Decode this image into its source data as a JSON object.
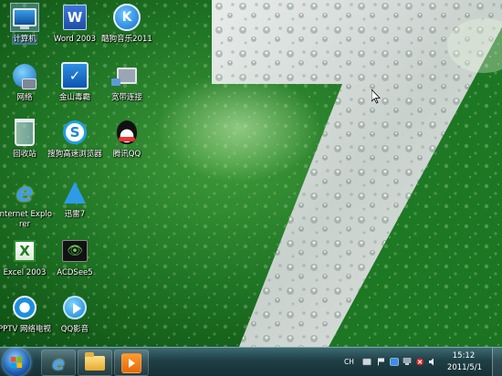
{
  "desktop": {
    "icons": [
      {
        "label": "计算机",
        "icon": "computer-icon"
      },
      {
        "label": "Word 2003",
        "icon": "word-icon"
      },
      {
        "label": "酷狗音乐2011",
        "icon": "kugou-icon"
      },
      {
        "label": "网络",
        "icon": "network-icon"
      },
      {
        "label": "金山毒霸",
        "icon": "jinshan-antivirus-icon"
      },
      {
        "label": "宽带连接",
        "icon": "broadband-connection-icon"
      },
      {
        "label": "回收站",
        "icon": "recycle-bin-icon"
      },
      {
        "label": "搜狗高速浏览器",
        "icon": "sogou-browser-icon"
      },
      {
        "label": "腾讯QQ",
        "icon": "qq-icon"
      },
      {
        "label": "Internet Explorer",
        "icon": "internet-explorer-icon"
      },
      {
        "label": "迅雷7",
        "icon": "xunlei-icon"
      },
      {
        "label": "Excel 2003",
        "icon": "excel-icon"
      },
      {
        "label": "ACDSee5",
        "icon": "acdsee-icon"
      },
      {
        "label": "PPTV 网络电视",
        "icon": "pptv-icon"
      },
      {
        "label": "QQ影音",
        "icon": "qq-player-icon"
      }
    ],
    "glyphs": {
      "word": "W",
      "kugou": "K",
      "jinshan": "✓",
      "sogou": "S",
      "ie": "e",
      "excel": "X",
      "acdsee": "👁"
    }
  },
  "taskbar": {
    "pinned": [
      {
        "name": "Internet Explorer",
        "icon": "internet-explorer-icon",
        "glyph": "e"
      },
      {
        "name": "Windows Explorer",
        "icon": "folder-icon"
      },
      {
        "name": "Windows Media Player",
        "icon": "media-player-icon"
      }
    ],
    "tray": {
      "language": "CH",
      "time": "15:12",
      "date": "2011/5/1"
    }
  },
  "colors": {
    "wallpaper_green": "#1b6a22",
    "taskbar": "#1f3f46",
    "accent_blue": "#1d5fb6"
  }
}
